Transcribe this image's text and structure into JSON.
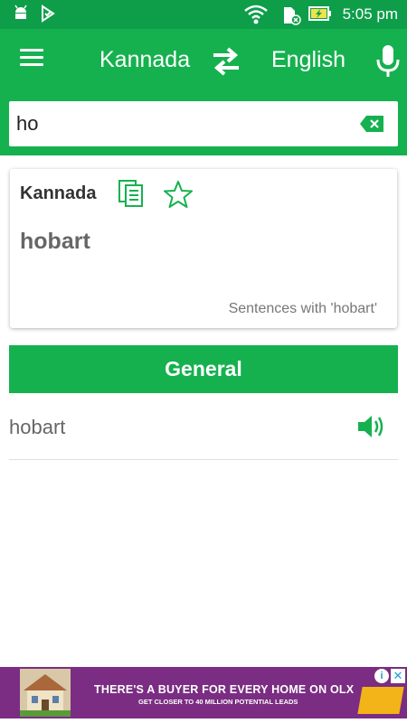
{
  "status_bar": {
    "time": "5:05 pm"
  },
  "app_bar": {
    "source_language": "Kannada",
    "target_language": "English"
  },
  "search": {
    "value": "ho"
  },
  "card": {
    "language": "Kannada",
    "word": "hobart",
    "sentences_link": "Sentences with 'hobart'"
  },
  "section": {
    "title": "General"
  },
  "results": [
    {
      "text": "hobart"
    }
  ],
  "ad": {
    "title": "THERE'S A BUYER FOR EVERY HOME ON OLX",
    "subtitle": "GET CLOSER TO 40 MILLION POTENTIAL LEADS"
  },
  "colors": {
    "primary": "#16b14f",
    "status_bar": "#0e9e4a",
    "ad_background": "#7a2d82"
  }
}
